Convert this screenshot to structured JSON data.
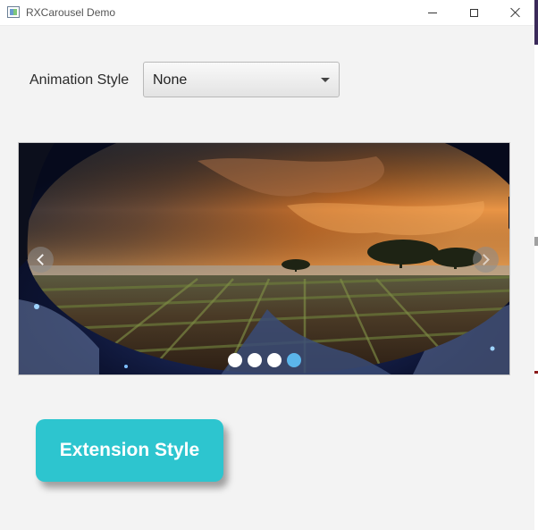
{
  "window": {
    "title": "RXCarousel Demo",
    "controls": {
      "minimize": "minimize-icon",
      "maximize": "maximize-icon",
      "close": "close-icon"
    }
  },
  "animation": {
    "label": "Animation Style",
    "selected": "None"
  },
  "carousel": {
    "slide_count": 4,
    "active_index": 3,
    "prev_icon": "chevron-left-icon",
    "next_icon": "chevron-right-icon",
    "active_dot_color": "#5bb5ea"
  },
  "extension_button": {
    "label": "Extension Style",
    "color": "#2dc5cf"
  }
}
